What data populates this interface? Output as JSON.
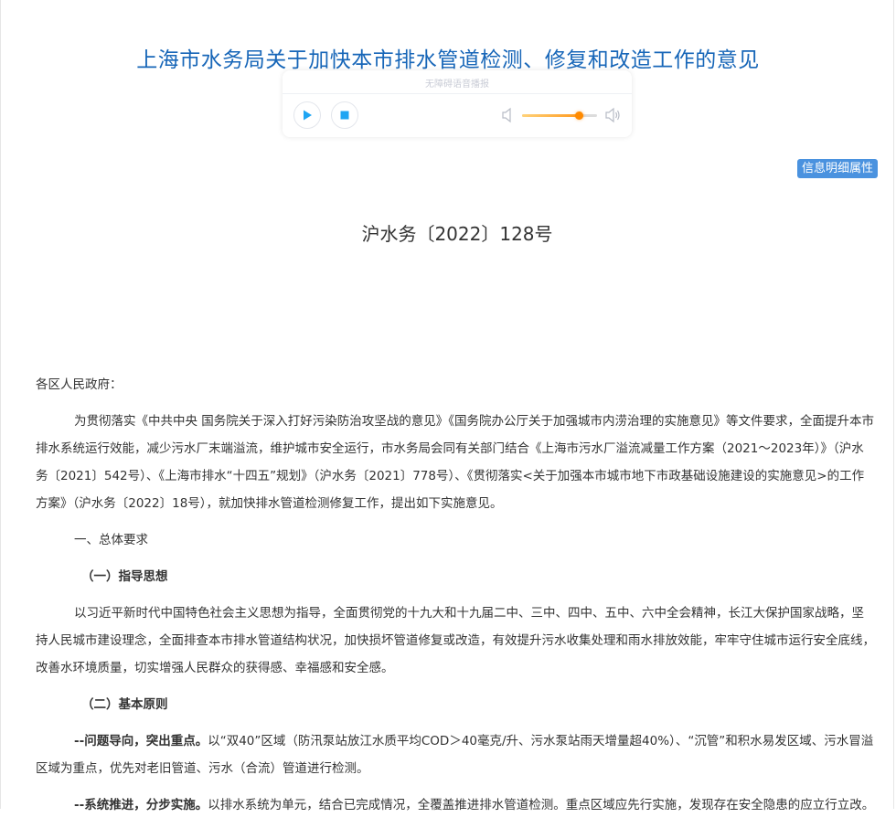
{
  "document": {
    "title": "上海市水务局关于加快本市排水管道检测、修复和改造工作的意见",
    "doc_number": "沪水务〔2022〕128号",
    "info_button": "信息明细属性",
    "salutation": "各区人民政府：",
    "intro": "为贯彻落实《中共中央 国务院关于深入打好污染防治攻坚战的意见》《国务院办公厅关于加强城市内涝治理的实施意见》等文件要求，全面提升本市排水系统运行效能，减少污水厂末端溢流，维护城市安全运行，市水务局会同有关部门结合《上海市污水厂溢流减量工作方案（2021～2023年）》（沪水务〔2021〕542号）、《上海市排水“十四五”规划》（沪水务〔2021〕778号）、《贯彻落实<关于加强本市城市地下市政基础设施建设的实施意见>的工作方案》（沪水务〔2022〕18号），就加快排水管道检测修复工作，提出如下实施意见。",
    "section1": "一、总体要求",
    "sub1_title": "（一）指导思想",
    "sub1_text": "以习近平新时代中国特色社会主义思想为指导，全面贯彻党的十九大和十九届二中、三中、四中、五中、六中全会精神，长江大保护国家战略，坚持人民城市建设理念，全面排查本市排水管道结构状况，加快损坏管道修复或改造，有效提升污水收集处理和雨水排放效能，牢牢守住城市运行安全底线，改善水环境质量，切实增强人民群众的获得感、幸福感和安全感。",
    "sub2_title": "（二）基本原则",
    "principle1_lead": "--问题导向，突出重点。",
    "principle1_text": "以“双40”区域（防汛泵站放江水质平均COD＞40毫克/升、污水泵站雨天增量超40%）、“沉管”和积水易发区域、污水冒溢区域为重点，优先对老旧管道、污水（合流）管道进行检测。",
    "principle2_lead": "--系统推进，分步实施。",
    "principle2_text": "以排水系统为单元，结合已完成情况，全覆盖推进排水管道检测。重点区域应先行实施，发现存在安全隐患的应立行立改。"
  },
  "player": {
    "label": "无障碍语音播报",
    "volume": 0.75
  },
  "icons": {
    "play": "play-icon",
    "stop": "stop-icon",
    "volume_low": "volume-low-icon",
    "volume_high": "volume-high-icon"
  },
  "colors": {
    "title": "#1766b8",
    "accent_button": "#4a92df",
    "control": "#1ea5f3",
    "volume": "#ff8a00"
  }
}
